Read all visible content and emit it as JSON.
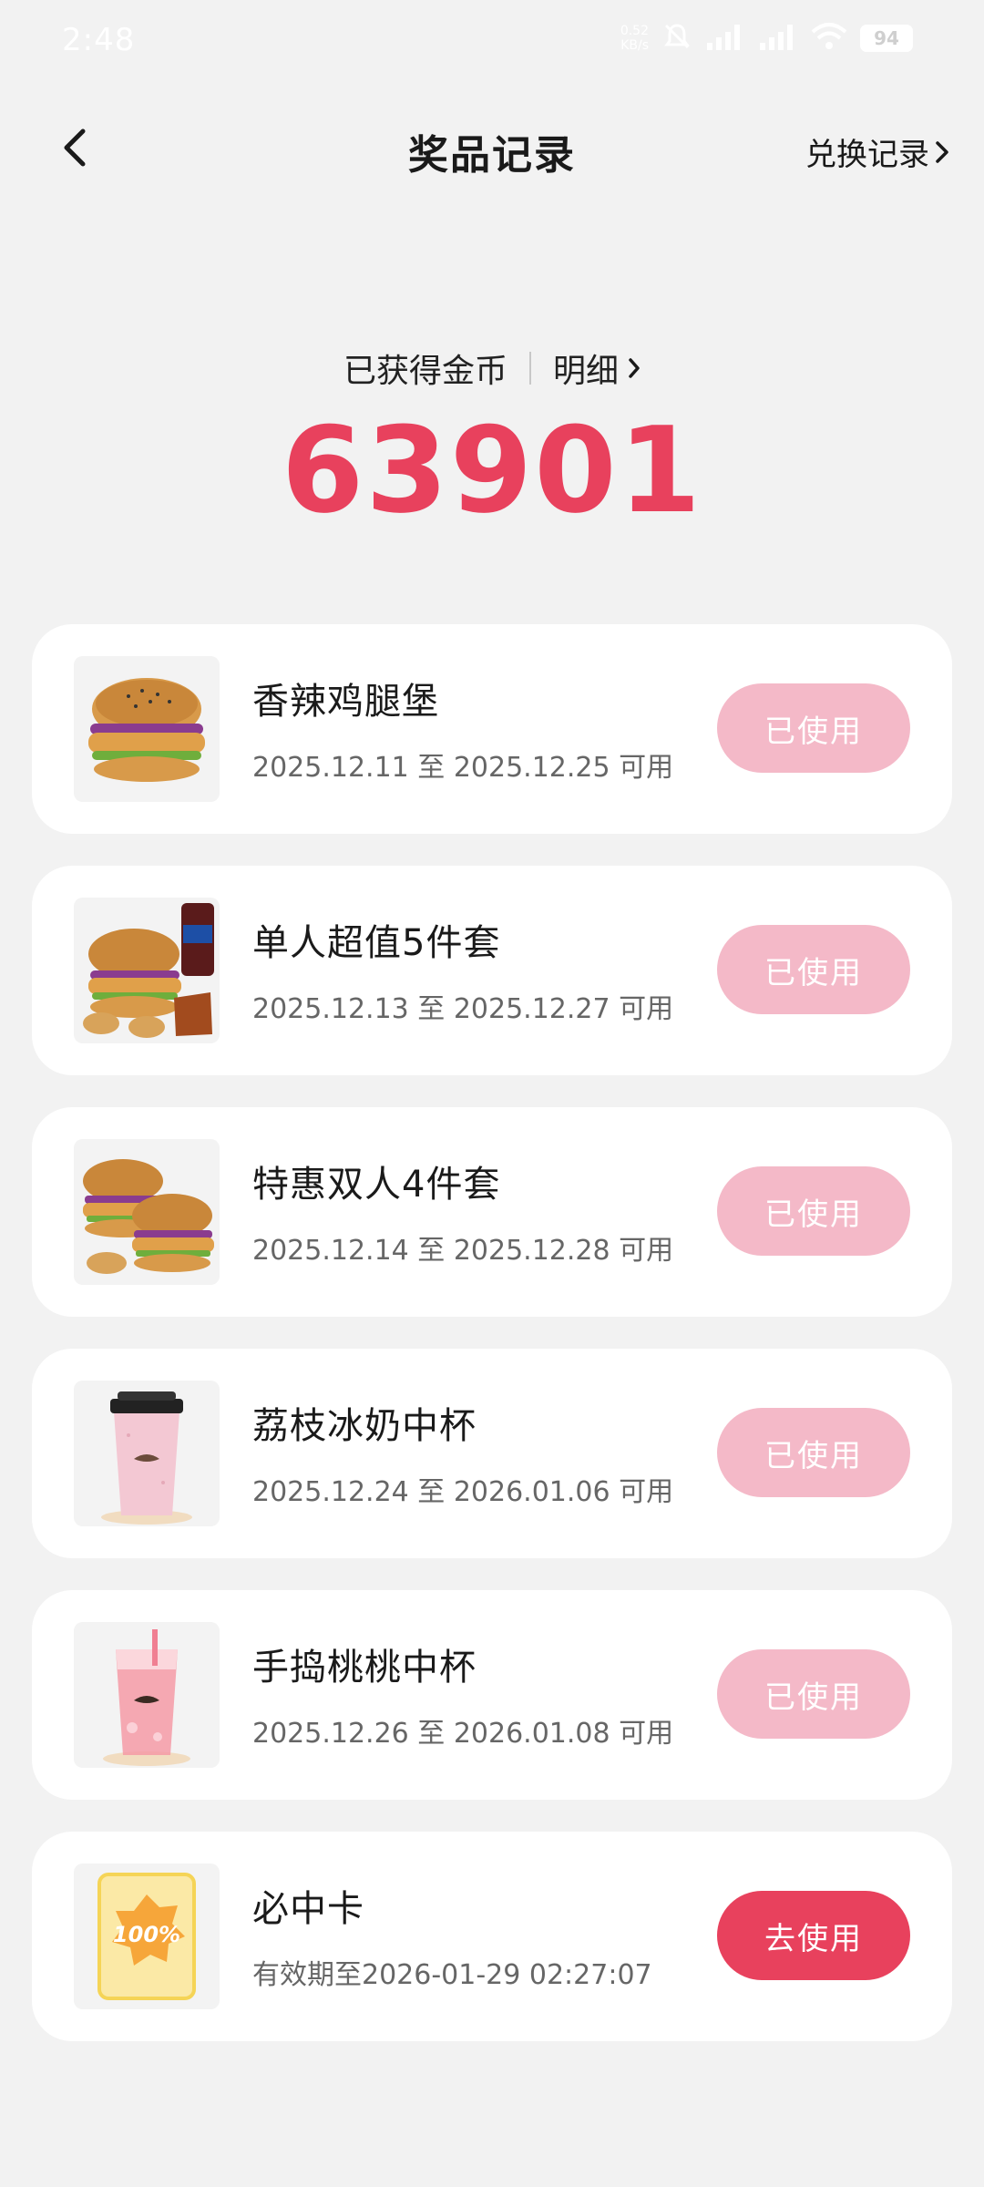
{
  "status_bar": {
    "time": "2:48",
    "net_speed_value": "0.52",
    "net_speed_unit": "KB/s",
    "battery": "94"
  },
  "header": {
    "title": "奖品记录",
    "exchange_link": "兑换记录"
  },
  "coins": {
    "label": "已获得金币",
    "detail_link": "明细",
    "value": "63901"
  },
  "prizes": [
    {
      "name": "香辣鸡腿堡",
      "validity": "2025.12.11 至 2025.12.25 可用",
      "button": "已使用",
      "used": true
    },
    {
      "name": "单人超值5件套",
      "validity": "2025.12.13 至 2025.12.27 可用",
      "button": "已使用",
      "used": true
    },
    {
      "name": "特惠双人4件套",
      "validity": "2025.12.14 至 2025.12.28 可用",
      "button": "已使用",
      "used": true
    },
    {
      "name": "荔枝冰奶中杯",
      "validity": "2025.12.24 至 2026.01.06 可用",
      "button": "已使用",
      "used": true
    },
    {
      "name": "手捣桃桃中杯",
      "validity": "2025.12.26 至 2026.01.08 可用",
      "button": "已使用",
      "used": true
    },
    {
      "name": "必中卡",
      "validity": "有效期至2026-01-29 02:27:07",
      "button": "去使用",
      "used": false,
      "badge": "100%"
    }
  ],
  "colors": {
    "accent": "#e8415d",
    "used_button": "#f4b9c8",
    "background": "#f2f2f2"
  }
}
